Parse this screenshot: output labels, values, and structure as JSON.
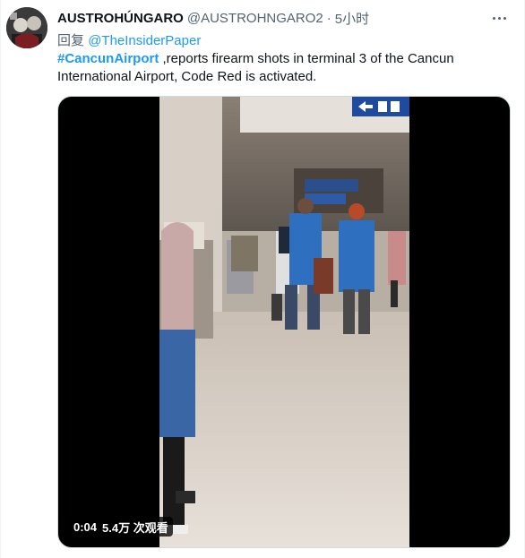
{
  "tweet": {
    "display_name": "AUSTROHÚNGARO",
    "handle": "@AUSTROHNGARO2",
    "separator": "·",
    "time": "5小时",
    "reply_prefix": "回复",
    "reply_mention": "@TheInsiderPaper",
    "hashtag": "#CancunAirport",
    "text": " ,reports firearm shots in terminal 3 of the Cancun International Airport, Code Red is activated.",
    "more_icon": "more-dots-icon",
    "avatar_icon": "profile-photo"
  },
  "video": {
    "elapsed": "0:04",
    "views": "5.4万 次观看",
    "airport_sign_icon": "arrow-left-wheelchair-icon"
  },
  "colors": {
    "accent": "#1d9bf0",
    "secondary_text": "#536471",
    "primary_text": "#0f1419",
    "media_letterbox": "#000000"
  }
}
